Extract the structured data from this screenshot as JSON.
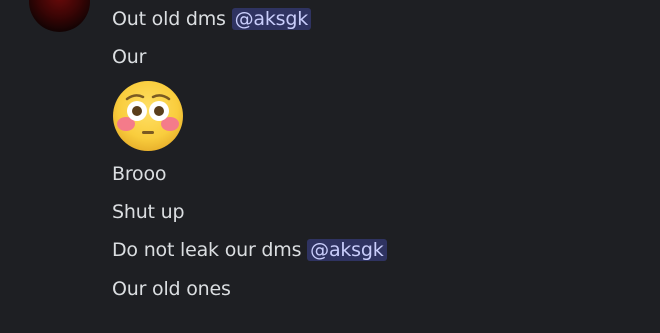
{
  "messages": [
    {
      "text": "Out old dms ",
      "mention": "@aksgk"
    },
    {
      "text": "Our"
    },
    {
      "emoji": "flushed-face-emoji"
    },
    {
      "text": "Brooo"
    },
    {
      "text": "Shut up"
    },
    {
      "text": "Do not leak our dms ",
      "mention": "@aksgk"
    },
    {
      "text": "Our old ones"
    }
  ],
  "colors": {
    "background": "#1e1f23",
    "text": "#dbdee1",
    "mention_bg": "#3b3f74",
    "mention_text": "#c9cdfb"
  }
}
